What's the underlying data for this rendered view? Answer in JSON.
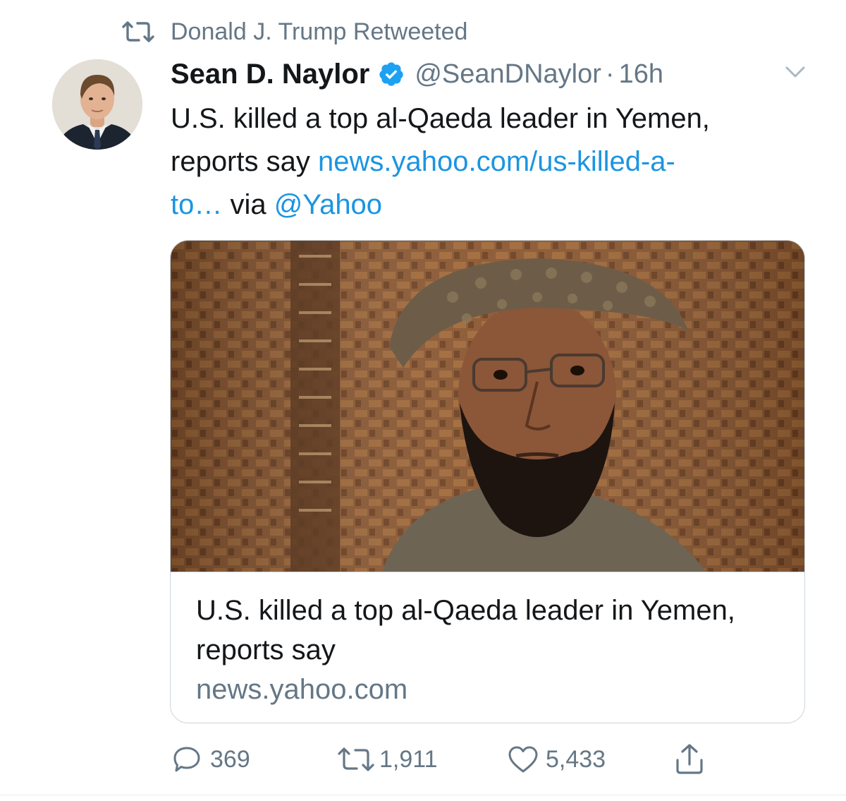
{
  "retweet_context": {
    "text": "Donald J. Trump Retweeted",
    "icon": "retweet-icon"
  },
  "tweet": {
    "author": {
      "display_name": "Sean D. Naylor",
      "handle": "@SeanDNaylor",
      "verified": true,
      "avatar_icon": "avatar-photo"
    },
    "separator": "·",
    "timestamp": "16h",
    "text": {
      "line1": "U.S. killed a top al-Qaeda leader in Yemen,",
      "line2_prefix": "reports say",
      "link_part1": "news.yahoo.com/us-killed-a-",
      "link_part2": "to…",
      "via_text": "via",
      "mention": "@Yahoo"
    },
    "card": {
      "title": "U.S. killed a top al-Qaeda leader in Yemen, reports say",
      "domain": "news.yahoo.com"
    },
    "actions": {
      "replies": "369",
      "retweets": "1,911",
      "likes": "5,433"
    }
  },
  "colors": {
    "text_primary": "#14171a",
    "text_secondary": "#657786",
    "link": "#1b95e0",
    "verified": "#1da1f2",
    "border": "#ccd6dd"
  }
}
